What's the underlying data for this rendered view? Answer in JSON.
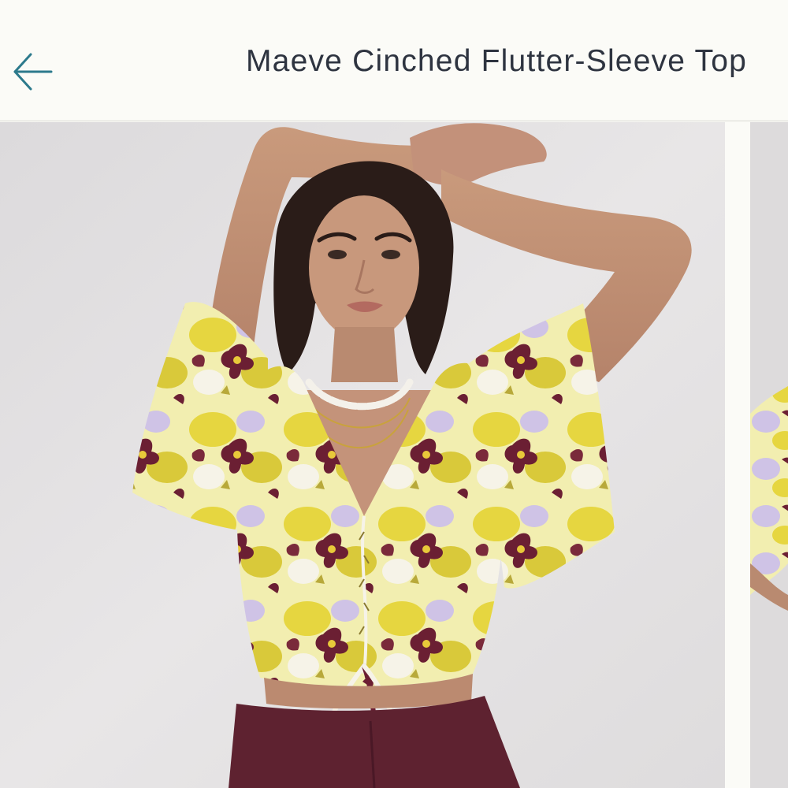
{
  "header": {
    "title": "Maeve Cinched Flutter-Sleeve Top",
    "back_icon": "arrow-left-icon"
  },
  "colors": {
    "header_bg": "#fbfbf7",
    "title_text": "#2e3440",
    "accent_teal": "#2c7a8c",
    "photo_bg": "#e6e4e5",
    "print_yellow": "#e8d84a",
    "print_maroon": "#6b1f33",
    "print_lavender": "#cfc3e6",
    "pants_maroon": "#5e2230"
  },
  "gallery": {
    "images": [
      {
        "name": "product-photo-1",
        "subject": "model wearing floral flutter-sleeve top"
      },
      {
        "name": "product-photo-2",
        "subject": "next product photo (partially visible)"
      }
    ]
  }
}
